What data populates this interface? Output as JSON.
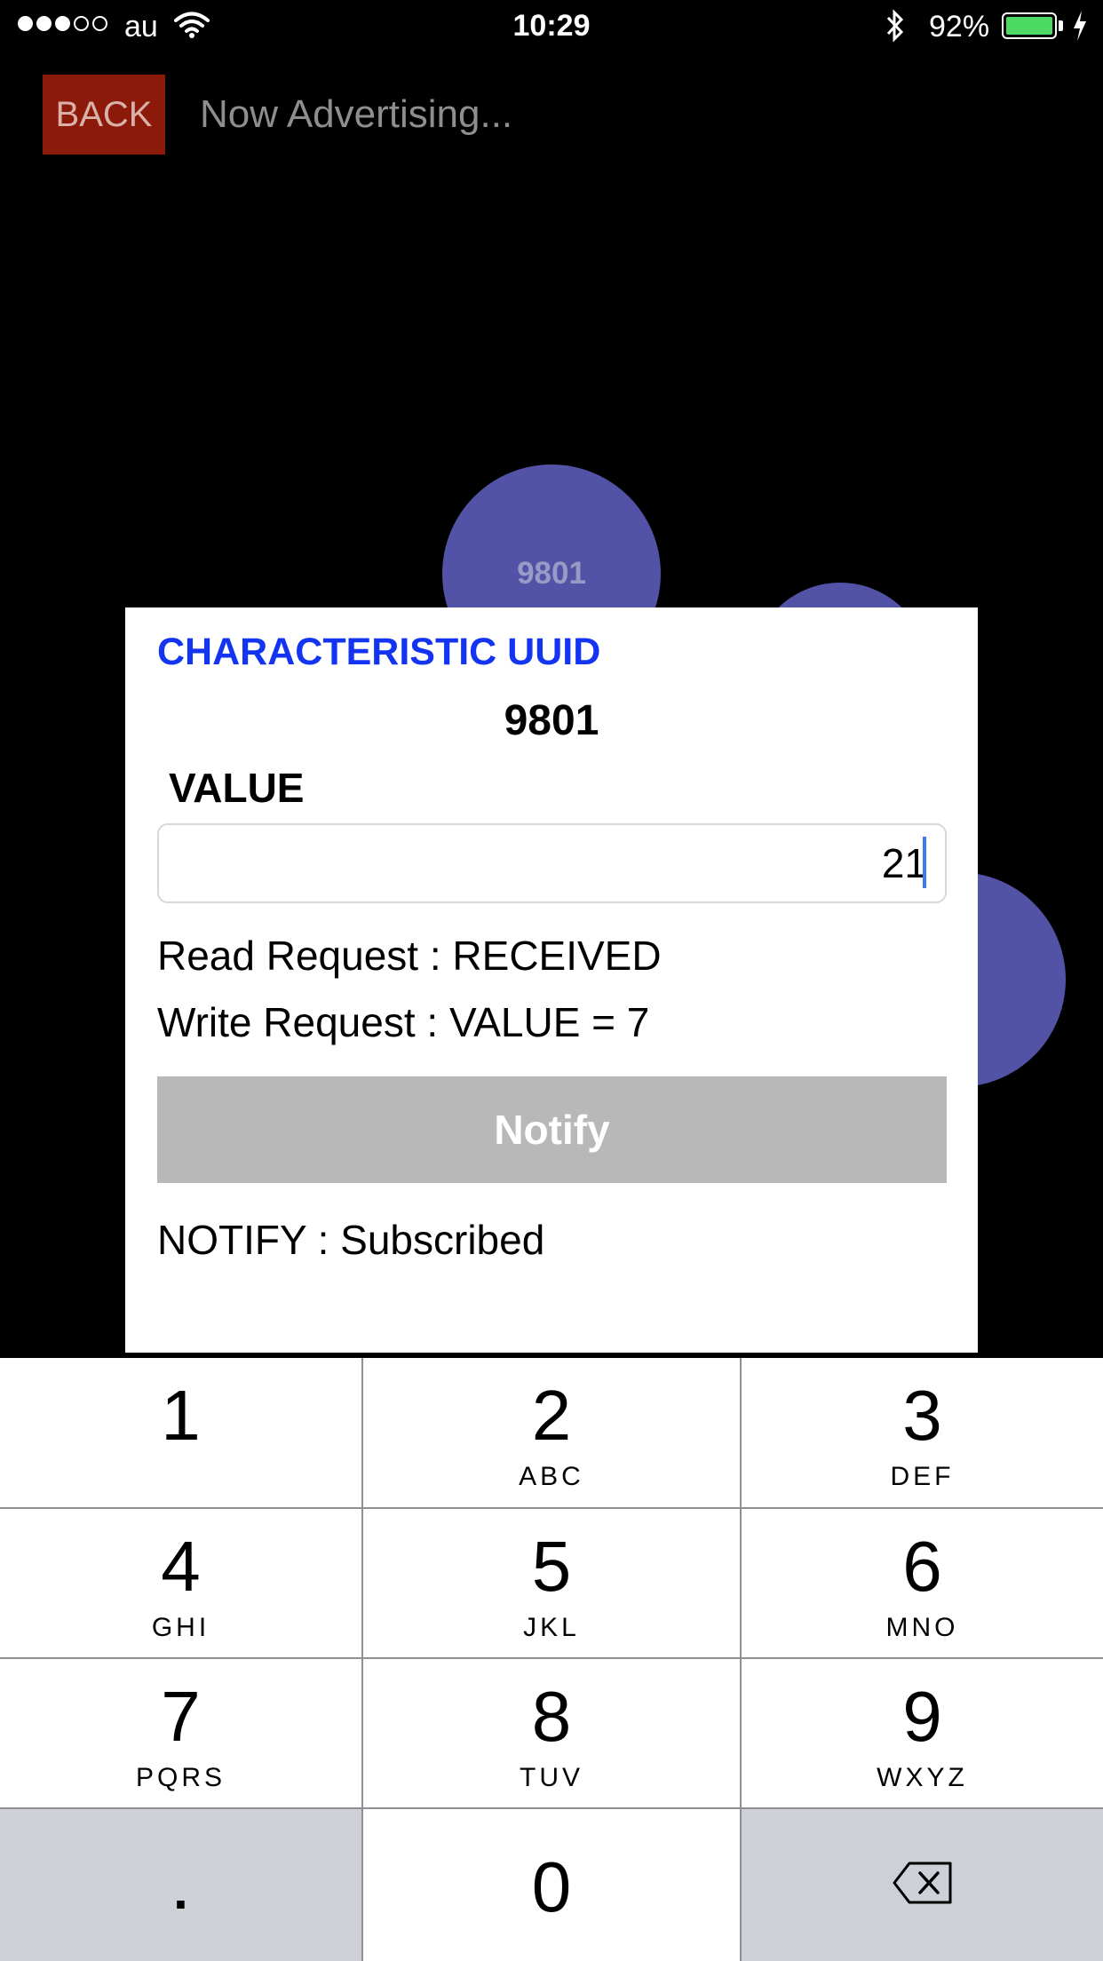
{
  "status_bar": {
    "carrier": "au",
    "time": "10:29",
    "battery_percent": "92%",
    "signal_bars_filled": 3,
    "signal_bars_total": 5,
    "battery_color": "#4cd964"
  },
  "nav": {
    "back_label": "BACK",
    "title": "Now Advertising...",
    "back_color": "#8c1a0a"
  },
  "bubbles": [
    {
      "label": "9801"
    },
    {
      "label": ""
    },
    {
      "label": ""
    }
  ],
  "dialog": {
    "characteristic_label": "CHARACTERISTIC UUID",
    "uuid": "9801",
    "value_label": "VALUE",
    "value_input": "21",
    "read_request": "Read Request : RECEIVED",
    "write_request": "Write Request : VALUE = 7",
    "notify_button": "Notify",
    "notify_status": "NOTIFY : Subscribed",
    "accent_color": "#1334f0"
  },
  "keypad": {
    "keys": [
      {
        "num": "1",
        "letters": ""
      },
      {
        "num": "2",
        "letters": "ABC"
      },
      {
        "num": "3",
        "letters": "DEF"
      },
      {
        "num": "4",
        "letters": "GHI"
      },
      {
        "num": "5",
        "letters": "JKL"
      },
      {
        "num": "6",
        "letters": "MNO"
      },
      {
        "num": "7",
        "letters": "PQRS"
      },
      {
        "num": "8",
        "letters": "TUV"
      },
      {
        "num": "9",
        "letters": "WXYZ"
      }
    ],
    "dot": ".",
    "zero": "0",
    "delete_icon": "backspace-icon"
  }
}
